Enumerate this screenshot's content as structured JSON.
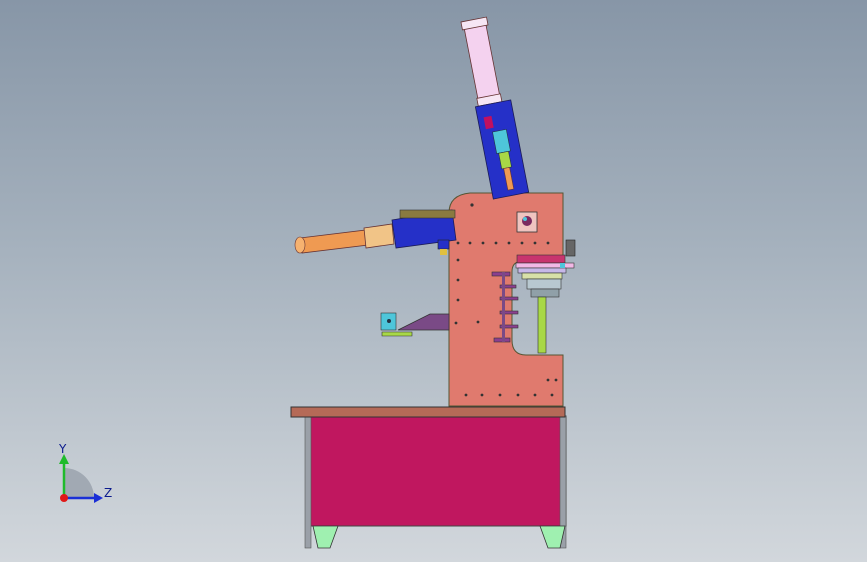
{
  "viewport": {
    "background_top": "#8796a7",
    "background_bottom": "#d2d7dc"
  },
  "model": {
    "frame_color": "#e07a6e",
    "table_top_color": "#b56a57",
    "cabinet_color": "#c0175f",
    "feet_color": "#9ff0b0",
    "cylinder_blue": "#2530c8",
    "rod_color": "#ef9a52",
    "pink_cylinder": "#f4d2ef",
    "green_column": "#a8d846",
    "purple_plate": "#7a4a86",
    "cyan_block": "#4ec6da"
  },
  "triad": {
    "y_label": "Y",
    "z_label": "Z",
    "y_color": "#1fbb2b",
    "z_color": "#1a2fd6",
    "x_color": "#e01818"
  }
}
